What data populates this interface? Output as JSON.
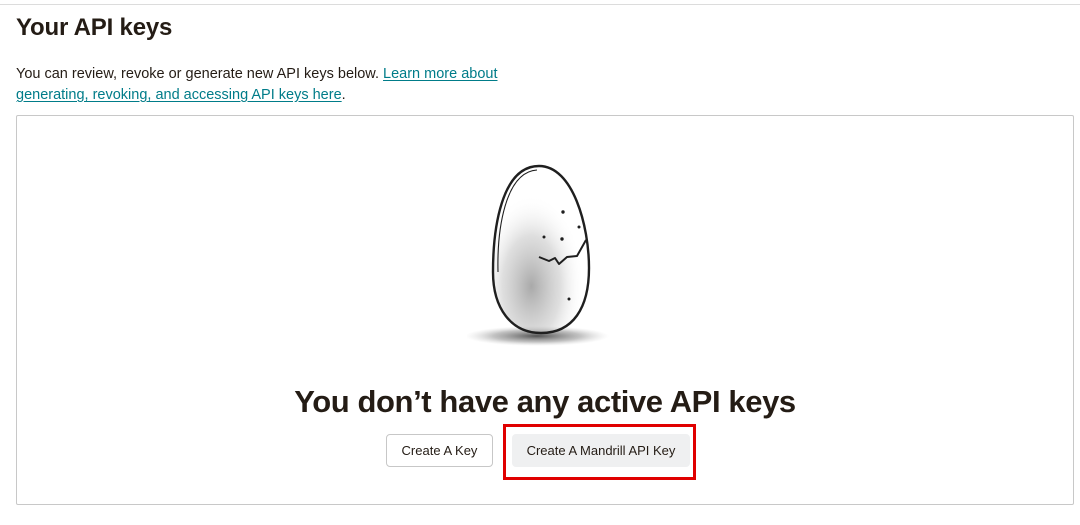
{
  "header": {
    "title": "Your API keys"
  },
  "intro": {
    "text": "You can review, revoke or generate new API keys below.",
    "link_text": "Learn more about generating, revoking, and accessing API keys here",
    "trailing": "."
  },
  "empty_state": {
    "illustration": "cracked-egg-illustration",
    "heading": "You don’t have any active API keys"
  },
  "actions": {
    "create_key_label": "Create A Key",
    "create_mandrill_label": "Create A Mandrill API Key"
  },
  "colors": {
    "link": "#007c89",
    "text": "#241c15",
    "highlight": "#e00000",
    "secondary_button_bg": "#eff0f1"
  }
}
